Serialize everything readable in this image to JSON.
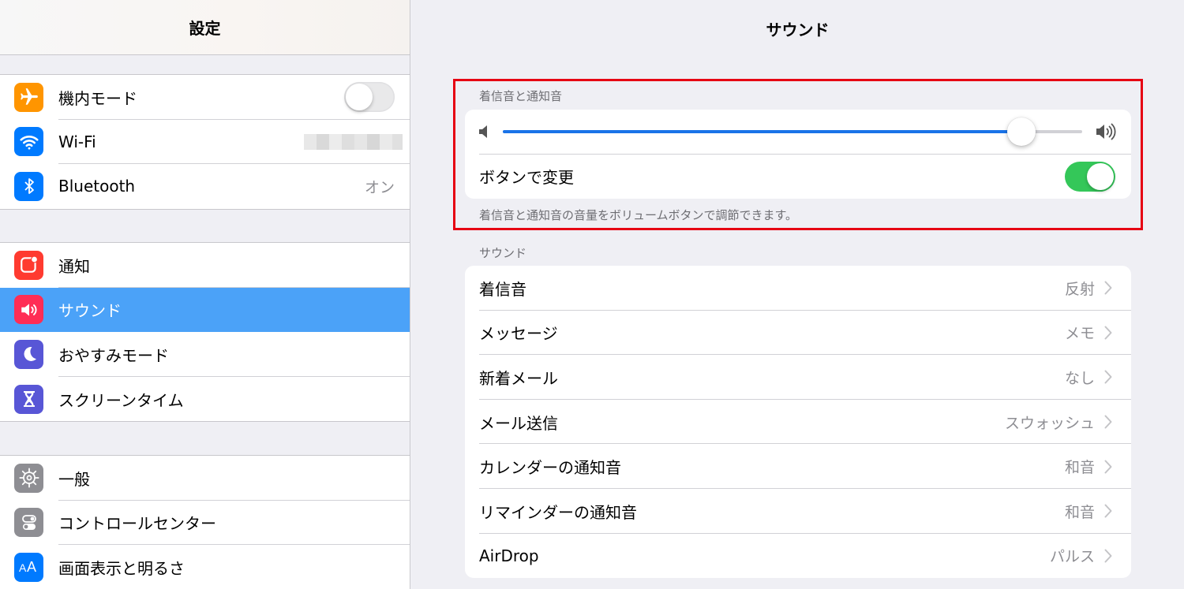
{
  "sidebar": {
    "title": "設定",
    "group1": [
      {
        "label": "機内モード",
        "icon": "airplane-icon",
        "color": "#ff9500",
        "toggle": false
      },
      {
        "label": "Wi-Fi",
        "icon": "wifi-icon",
        "color": "#007aff"
      },
      {
        "label": "Bluetooth",
        "icon": "bluetooth-icon",
        "color": "#007aff",
        "value": "オン"
      }
    ],
    "group2": [
      {
        "label": "通知",
        "icon": "notification-icon",
        "color": "#ff3b30"
      },
      {
        "label": "サウンド",
        "icon": "speaker-icon",
        "color": "#ff2d55",
        "selected": true
      },
      {
        "label": "おやすみモード",
        "icon": "moon-icon",
        "color": "#5856d6"
      },
      {
        "label": "スクリーンタイム",
        "icon": "hourglass-icon",
        "color": "#5856d6"
      }
    ],
    "group3": [
      {
        "label": "一般",
        "icon": "gear-icon",
        "color": "#8e8e93"
      },
      {
        "label": "コントロールセンター",
        "icon": "switches-icon",
        "color": "#8e8e93"
      },
      {
        "label": "画面表示と明るさ",
        "icon": "text-size-icon",
        "color": "#007aff"
      }
    ],
    "accent_selected": "#4ba2f8"
  },
  "main": {
    "title": "サウンド",
    "ringer": {
      "header": "着信音と通知音",
      "volume_fraction": 0.895,
      "change_with_buttons_label": "ボタンで変更",
      "change_with_buttons": true,
      "footer": "着信音と通知音の音量をボリュームボタンで調節できます。"
    },
    "sounds": {
      "header": "サウンド",
      "rows": [
        {
          "label": "着信音",
          "value": "反射"
        },
        {
          "label": "メッセージ",
          "value": "メモ"
        },
        {
          "label": "新着メール",
          "value": "なし"
        },
        {
          "label": "メール送信",
          "value": "スウォッシュ"
        },
        {
          "label": "カレンダーの通知音",
          "value": "和音"
        },
        {
          "label": "リマインダーの通知音",
          "value": "和音"
        },
        {
          "label": "AirDrop",
          "value": "パルス"
        }
      ]
    },
    "highlight_color": "#e60012",
    "toggle_on_color": "#34c759",
    "slider_color": "#1a73e8"
  }
}
